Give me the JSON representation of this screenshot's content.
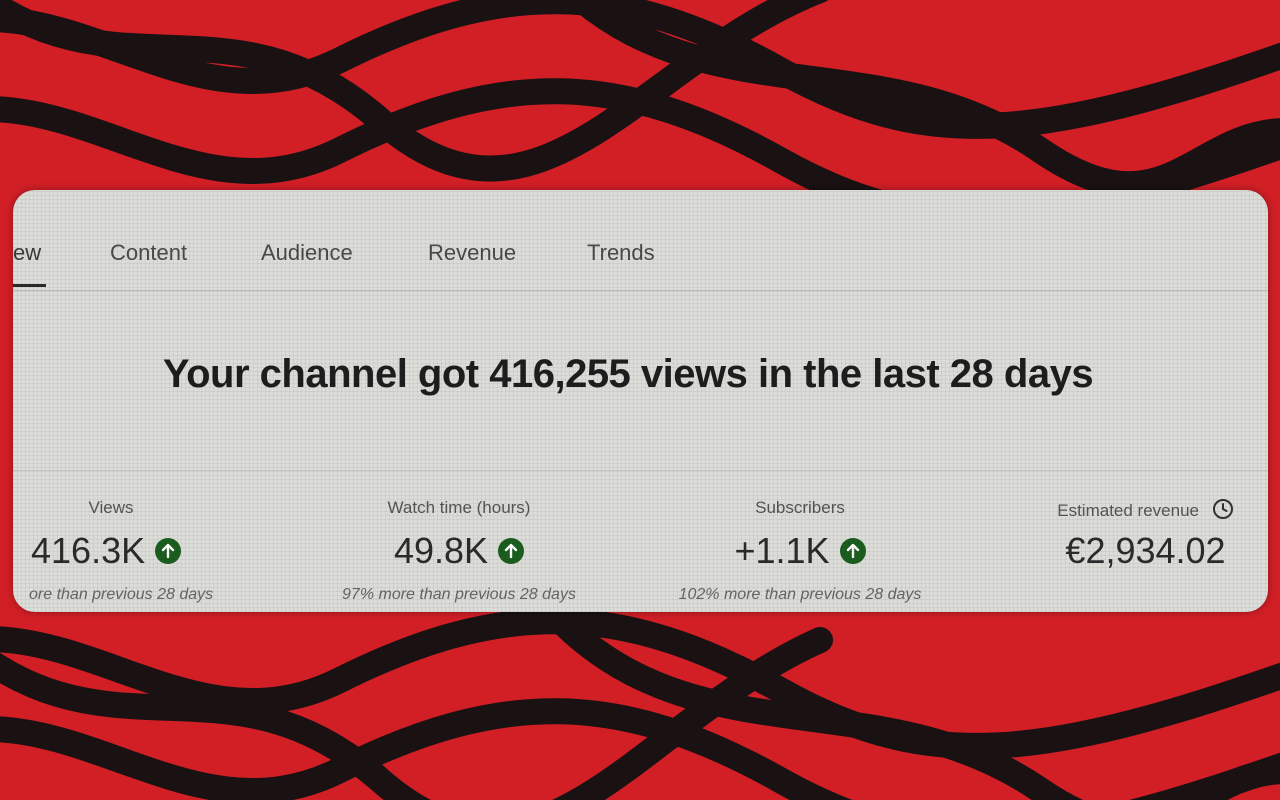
{
  "tabs": [
    {
      "label": "ew"
    },
    {
      "label": "Content"
    },
    {
      "label": "Audience"
    },
    {
      "label": "Revenue"
    },
    {
      "label": "Trends"
    }
  ],
  "headline": "Your channel got 416,255 views in the last 28 days",
  "metrics": {
    "views": {
      "label": "Views",
      "value": "416.3K",
      "note": "ore than previous 28 days"
    },
    "watch_time": {
      "label": "Watch time (hours)",
      "value": "49.8K",
      "note": "97% more than previous 28 days"
    },
    "subscribers": {
      "label": "Subscribers",
      "value": "+1.1K",
      "note": "102% more than previous 28 days"
    },
    "revenue": {
      "label": "Estimated revenue",
      "value": "€2,934.02"
    }
  },
  "icons": {
    "trend_up": "arrow-up-circle-icon",
    "clock": "clock-icon"
  },
  "colors": {
    "background": "#d21f26",
    "wave": "#111111",
    "up_badge": "#1b5e20"
  }
}
